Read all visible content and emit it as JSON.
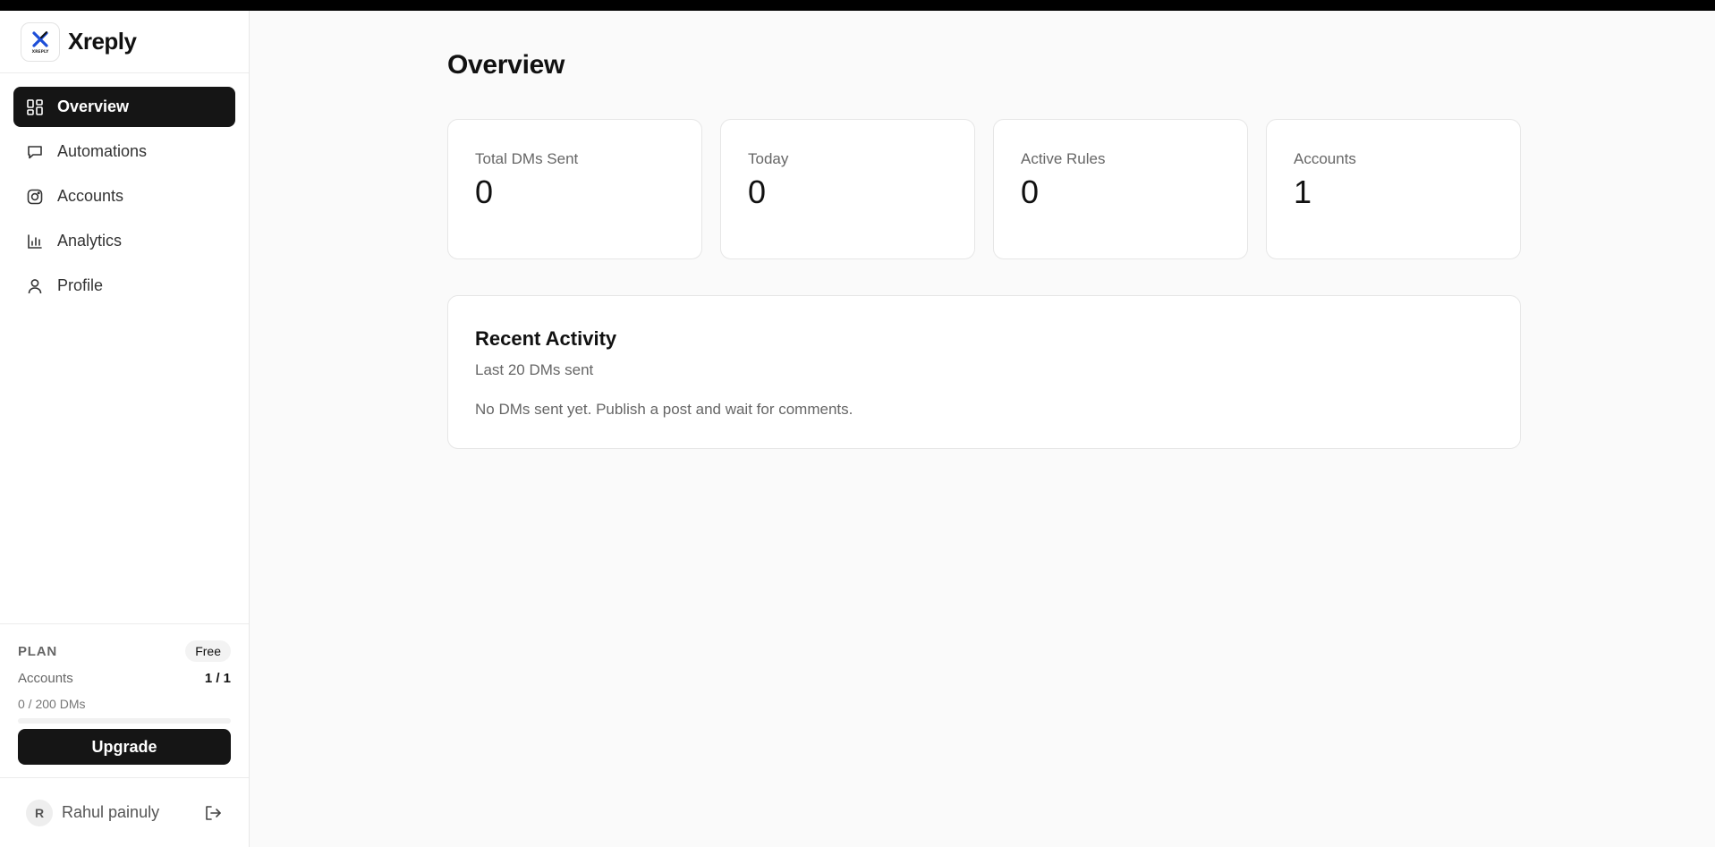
{
  "app": {
    "name": "Xreply",
    "logo_text": "XREPLY"
  },
  "sidebar": {
    "items": [
      {
        "label": "Overview",
        "icon": "dashboard-icon",
        "active": true
      },
      {
        "label": "Automations",
        "icon": "message-icon",
        "active": false
      },
      {
        "label": "Accounts",
        "icon": "instagram-icon",
        "active": false
      },
      {
        "label": "Analytics",
        "icon": "bar-chart-icon",
        "active": false
      },
      {
        "label": "Profile",
        "icon": "user-icon",
        "active": false
      }
    ],
    "plan": {
      "title": "PLAN",
      "badge": "Free",
      "accounts_label": "Accounts",
      "accounts_value": "1 / 1",
      "dms_label": "0 / 200 DMs",
      "dms_progress_percent": 0,
      "upgrade_label": "Upgrade"
    },
    "user": {
      "initial": "R",
      "name": "Rahul painuly"
    }
  },
  "main": {
    "title": "Overview",
    "stats": [
      {
        "label": "Total DMs Sent",
        "value": "0"
      },
      {
        "label": "Today",
        "value": "0"
      },
      {
        "label": "Active Rules",
        "value": "0"
      },
      {
        "label": "Accounts",
        "value": "1"
      }
    ],
    "activity": {
      "title": "Recent Activity",
      "subtitle": "Last 20 DMs sent",
      "empty_text": "No DMs sent yet. Publish a post and wait for comments."
    }
  },
  "colors": {
    "accent": "#151515",
    "background": "#fafafa",
    "logo_blue": "#1d4ed8"
  }
}
